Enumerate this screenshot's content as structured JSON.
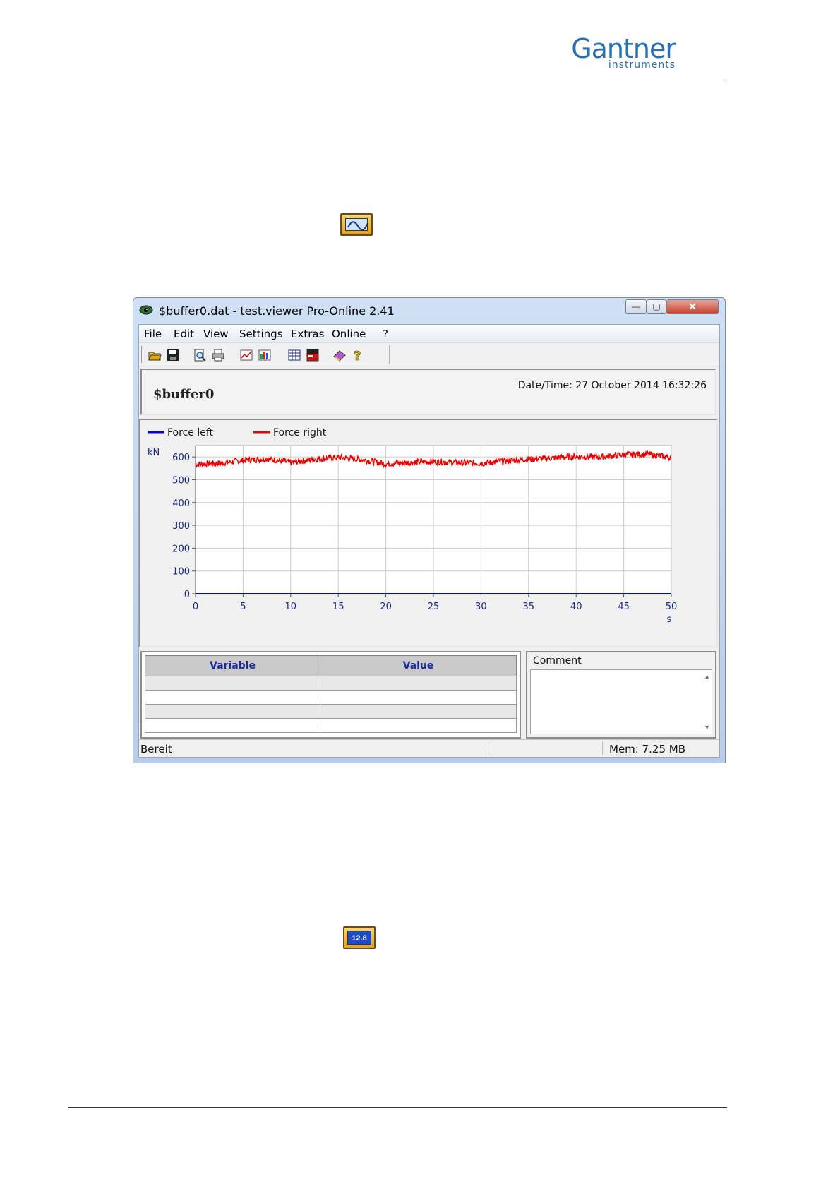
{
  "brand": {
    "name": "Gantner",
    "sub": "instruments",
    "color": "#2c6fb0"
  },
  "icons": {
    "inline_icon_1": "scope-icon",
    "inline_icon_2": "numeric-display-icon",
    "numeric_display_value": "12.8"
  },
  "window": {
    "title": "$buffer0.dat - test.viewer Pro-Online 2.41",
    "buttons": {
      "minimize": "—",
      "maximize": "▢",
      "close": "✕"
    },
    "menu": [
      "File",
      "Edit",
      "View",
      "Settings",
      "Extras",
      "Online",
      "?"
    ],
    "toolbar": [
      "open-folder-icon",
      "save-icon",
      "print-preview-icon",
      "print-icon",
      "line-chart-icon",
      "bar-chart-icon",
      "table-icon",
      "report-icon",
      "book-icon",
      "help-icon"
    ]
  },
  "header": {
    "buffer_name": "$buffer0",
    "datetime": "Date/Time: 27 October 2014 16:32:26"
  },
  "chart_data": {
    "type": "line",
    "ylabel": "kN",
    "xlabel": "s",
    "xlim": [
      0,
      50
    ],
    "ylim": [
      0,
      650
    ],
    "x_ticks": [
      0,
      5,
      10,
      15,
      20,
      25,
      30,
      35,
      40,
      45,
      50
    ],
    "y_ticks": [
      0,
      100,
      200,
      300,
      400,
      500,
      600
    ],
    "grid": true,
    "legend_position": "top-left",
    "series": [
      {
        "name": "Force left",
        "color": "#0000ee",
        "x": [
          0,
          50
        ],
        "y": [
          0,
          0
        ]
      },
      {
        "name": "Force right",
        "color": "#ee0000",
        "x": [
          0,
          2.5,
          5,
          7.5,
          10,
          12.5,
          15,
          17.5,
          20,
          22.5,
          25,
          27.5,
          30,
          32.5,
          35,
          37.5,
          40,
          42.5,
          45,
          47.5,
          50
        ],
        "y": [
          568,
          572,
          585,
          592,
          575,
          590,
          598,
          588,
          570,
          575,
          580,
          575,
          572,
          582,
          590,
          595,
          602,
          600,
          610,
          612,
          598
        ]
      }
    ]
  },
  "table": {
    "headers": [
      "Variable",
      "Value"
    ],
    "row_count": 4
  },
  "comment": {
    "label": "Comment"
  },
  "status": {
    "left": "Bereit",
    "right": "Mem: 7.25 MB"
  }
}
